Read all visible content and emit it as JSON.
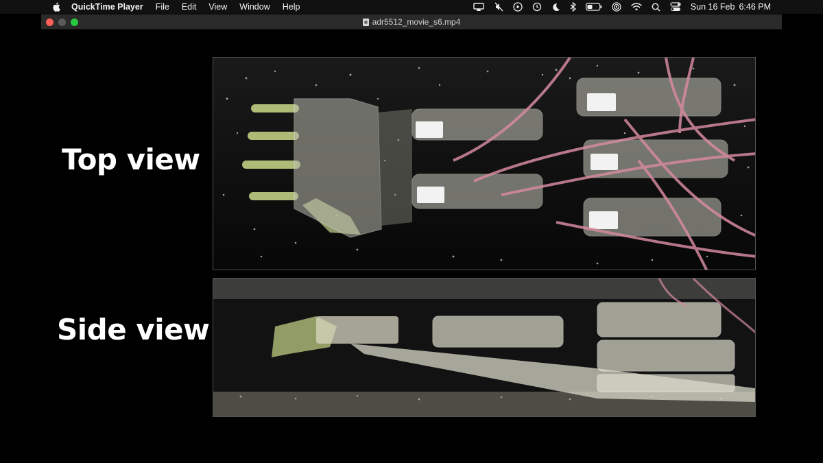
{
  "menubar": {
    "app_name": "QuickTime Player",
    "menus": [
      "File",
      "Edit",
      "View",
      "Window",
      "Help"
    ],
    "status_icons": [
      "display-icon",
      "mute-icon",
      "play-icon",
      "time-machine-icon",
      "moon-icon",
      "bluetooth-icon",
      "battery-icon",
      "airdrop-icon",
      "wifi-icon",
      "search-icon",
      "control-center-icon"
    ],
    "date": "Sun 16 Feb",
    "time": "6:46 PM"
  },
  "window": {
    "title": "adr5512_movie_s6.mp4"
  },
  "video": {
    "top_label": "Top view",
    "side_label": "Side view"
  }
}
